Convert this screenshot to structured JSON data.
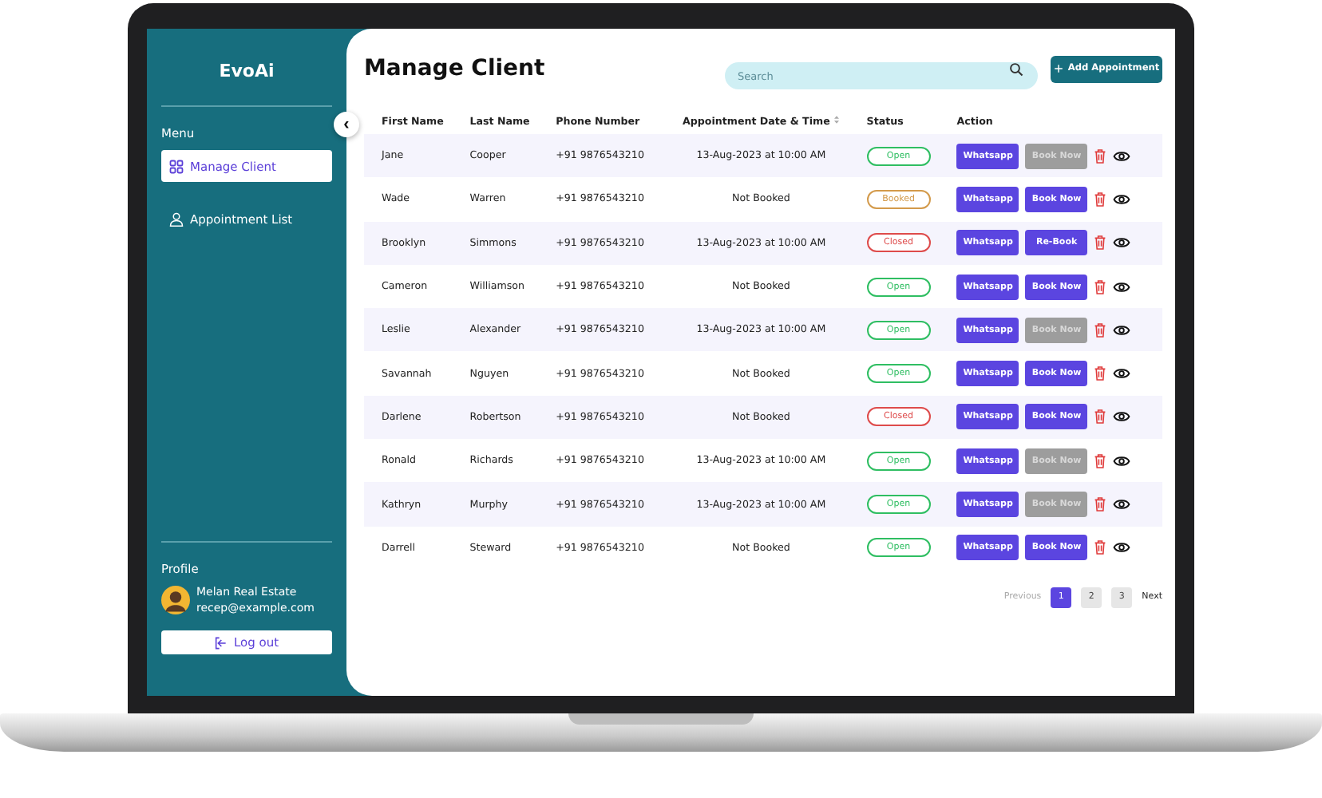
{
  "sidebar": {
    "brand": "EvoAi",
    "menu_title": "Menu",
    "items": [
      {
        "label": "Manage Client",
        "selected": true
      },
      {
        "label": "Appointment List",
        "selected": false
      }
    ],
    "profile_title": "Profile",
    "profile_name": "Melan Real Estate",
    "profile_email": "recep@example.com",
    "logout": "Log out"
  },
  "collapse_button": "‹",
  "page_title": "Manage Client",
  "search": {
    "placeholder": "Search"
  },
  "add_button": "Add Appointment",
  "table": {
    "columns": [
      "First Name",
      "Last Name",
      "Phone Number",
      "Appointment Date & Time",
      "Status",
      "Action"
    ],
    "rows": [
      {
        "first": "Jane",
        "last": "Cooper",
        "phone": "+91 9876543210",
        "date": "13-Aug-2023 at 10:00 AM",
        "status": {
          "text": "Open",
          "color": "#2fbe62"
        },
        "whatsapp": "Whatsapp",
        "book": "Book Now",
        "book_disabled": true
      },
      {
        "first": "Wade",
        "last": "Warren",
        "phone": "+91 9876543210",
        "date": "Not Booked",
        "status": {
          "text": "Booked",
          "color": "#d39a4b"
        },
        "whatsapp": "Whatsapp",
        "book": "Book Now",
        "book_disabled": false
      },
      {
        "first": "Brooklyn",
        "last": "Simmons",
        "phone": "+91 9876543210",
        "date": "13-Aug-2023 at 10:00 AM",
        "status": {
          "text": "Closed",
          "color": "#de4b4b"
        },
        "whatsapp": "Whatsapp",
        "book": "Re-Book",
        "book_disabled": false
      },
      {
        "first": "Cameron",
        "last": "Williamson",
        "phone": "+91 9876543210",
        "date": "Not Booked",
        "status": {
          "text": "Open",
          "color": "#2fbe62"
        },
        "whatsapp": "Whatsapp",
        "book": "Book Now",
        "book_disabled": false
      },
      {
        "first": "Leslie",
        "last": "Alexander",
        "phone": "+91 9876543210",
        "date": "13-Aug-2023 at 10:00 AM",
        "status": {
          "text": "Open",
          "color": "#2fbe62"
        },
        "whatsapp": "Whatsapp",
        "book": "Book Now",
        "book_disabled": true
      },
      {
        "first": "Savannah",
        "last": "Nguyen",
        "phone": "+91 9876543210",
        "date": "Not Booked",
        "status": {
          "text": "Open",
          "color": "#2fbe62"
        },
        "whatsapp": "Whatsapp",
        "book": "Book Now",
        "book_disabled": false
      },
      {
        "first": "Darlene",
        "last": "Robertson",
        "phone": "+91 9876543210",
        "date": "Not Booked",
        "status": {
          "text": "Closed",
          "color": "#de4b4b"
        },
        "whatsapp": "Whatsapp",
        "book": "Book Now",
        "book_disabled": false
      },
      {
        "first": "Ronald",
        "last": "Richards",
        "phone": "+91 9876543210",
        "date": "13-Aug-2023 at 10:00 AM",
        "status": {
          "text": "Open",
          "color": "#2fbe62"
        },
        "whatsapp": "Whatsapp",
        "book": "Book Now",
        "book_disabled": true
      },
      {
        "first": "Kathryn",
        "last": "Murphy",
        "phone": "+91 9876543210",
        "date": "13-Aug-2023 at 10:00 AM",
        "status": {
          "text": "Open",
          "color": "#2fbe62"
        },
        "whatsapp": "Whatsapp",
        "book": "Book Now",
        "book_disabled": true
      },
      {
        "first": "Darrell",
        "last": "Steward",
        "phone": "+91 9876543210",
        "date": "Not Booked",
        "status": {
          "text": "Open",
          "color": "#2fbe62"
        },
        "whatsapp": "Whatsapp",
        "book": "Book Now",
        "book_disabled": false
      }
    ]
  },
  "pagination": {
    "previous": "Previous",
    "previous_disabled": true,
    "pages": [
      {
        "label": "1",
        "selected": true
      },
      {
        "label": "2",
        "selected": false
      },
      {
        "label": "3",
        "selected": false
      }
    ],
    "next": "Next"
  }
}
